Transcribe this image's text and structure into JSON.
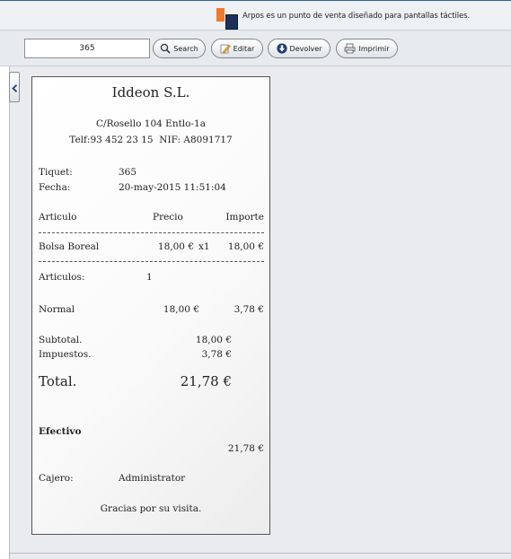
{
  "header": {
    "description": "Arpos es un punto de venta diseñado para pantallas táctiles."
  },
  "toolbar": {
    "ticket_value": "365",
    "search_label": "Search",
    "editar_label": "Editar",
    "devolver_label": "Devolver",
    "imprimir_label": "Imprimir"
  },
  "receipt": {
    "company": "Iddeon S.L.",
    "address": "C/Rosello 104 Entlo-1a",
    "contact": "Telf:93 452 23 15  NIF: A8091717",
    "ticket_label": "Tiquet:",
    "ticket_number": "365",
    "date_label": "Fecha:",
    "date_value": "20-may-2015 11:51:04",
    "col_article": "Articulo",
    "col_price": "Precio",
    "col_amount": "Importe",
    "items": [
      {
        "name": "Bolsa Boreal",
        "price": "18,00 €",
        "qty": "x1",
        "amount": "18,00 €"
      }
    ],
    "articles_label": "Articulos:",
    "articles_count": "1",
    "tax_name": "Normal",
    "tax_base": "18,00 €",
    "tax_amount": "3,78 €",
    "subtotal_label": "Subtotal.",
    "subtotal_value": "18,00 €",
    "taxes_label": "Impuestos.",
    "taxes_value": "3,78 €",
    "total_label": "Total.",
    "total_value": "21,78 €",
    "payment_label": "Efectivo",
    "payment_value": "21,78 €",
    "cashier_label": "Cajero:",
    "cashier_name": "Administrator",
    "thanks": "Gracias por su visita."
  },
  "colors": {
    "header_border": "#2a5fa8",
    "logo_orange": "#f07a2b",
    "logo_blue": "#1c2f59",
    "panel_bg": "#e9ebee"
  }
}
